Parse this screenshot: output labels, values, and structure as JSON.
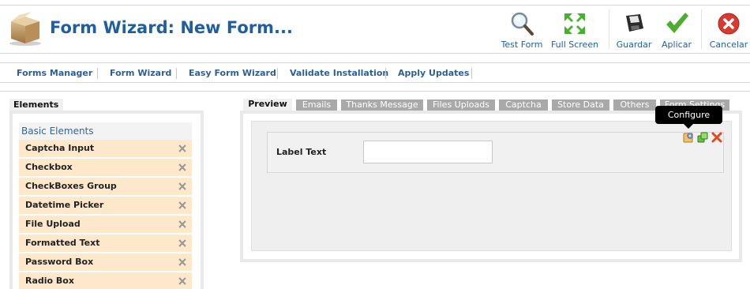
{
  "header": {
    "title": "Form Wizard: New Form...",
    "toolbar": [
      {
        "label": "Test Form",
        "icon": "magnifier-icon"
      },
      {
        "label": "Full Screen",
        "icon": "fullscreen-arrows-icon"
      },
      {
        "label": "Guardar",
        "icon": "save-disk-icon"
      },
      {
        "label": "Aplicar",
        "icon": "checkmark-icon"
      },
      {
        "label": "Cancelar",
        "icon": "cancel-x-icon"
      }
    ]
  },
  "nav": {
    "items": [
      {
        "label": "Forms Manager"
      },
      {
        "label": "Form Wizard"
      },
      {
        "label": "Easy Form Wizard"
      },
      {
        "label": "Validate Installation"
      },
      {
        "label": "Apply Updates"
      }
    ]
  },
  "elements": {
    "tab_label": "Elements",
    "group_label": "Basic Elements",
    "items": [
      {
        "label": "Captcha Input"
      },
      {
        "label": "Checkbox"
      },
      {
        "label": "CheckBoxes Group"
      },
      {
        "label": "Datetime Picker"
      },
      {
        "label": "File Upload"
      },
      {
        "label": "Formatted Text"
      },
      {
        "label": "Password Box"
      },
      {
        "label": "Radio Box"
      }
    ]
  },
  "preview": {
    "tabs": [
      {
        "label": "Preview",
        "active": true
      },
      {
        "label": "Emails"
      },
      {
        "label": "Thanks Message"
      },
      {
        "label": "Files Uploads"
      },
      {
        "label": "Captcha"
      },
      {
        "label": "Store Data"
      },
      {
        "label": "Others"
      },
      {
        "label": "Form Settings"
      }
    ],
    "field_label": "Label Text",
    "field_value": "",
    "tooltip": "Configure"
  },
  "colors": {
    "accent": "#1f5f9f",
    "element_bg": "#fde8cc",
    "tab_inactive": "#a9a9a9"
  }
}
